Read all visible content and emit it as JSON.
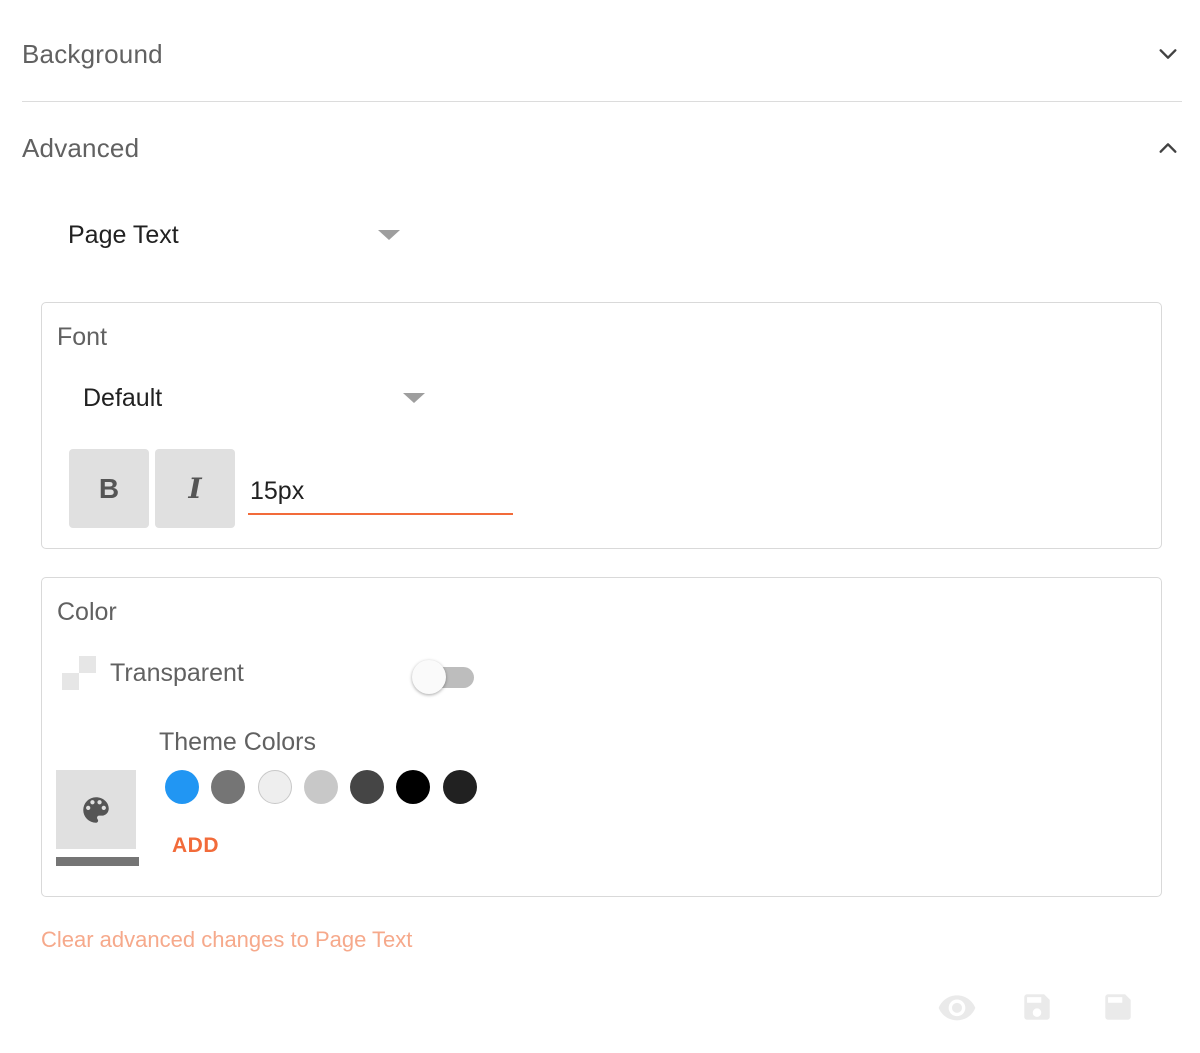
{
  "sections": {
    "background": {
      "title": "Background",
      "icon": "chevron-down-icon"
    },
    "advanced": {
      "title": "Advanced",
      "icon": "chevron-up-icon"
    }
  },
  "target_select": {
    "value": "Page Text"
  },
  "font_panel": {
    "title": "Font",
    "font_select": {
      "value": "Default"
    },
    "bold_label": "B",
    "italic_label": "I",
    "size": "15px"
  },
  "color_panel": {
    "title": "Color",
    "transparent_label": "Transparent",
    "transparent_on": false,
    "theme_colors_label": "Theme Colors",
    "swatches": [
      "#2196f3",
      "#757575",
      "#eeeeee",
      "#c8c8c8",
      "#454545",
      "#000000",
      "#212121"
    ],
    "add_label": "ADD"
  },
  "clear_label": "Clear advanced changes to Page Text",
  "footer_icons": [
    "eye-icon",
    "save-as-icon",
    "save-icon"
  ],
  "colors": {
    "accent": "#f26b3a",
    "accent_light": "#f6a98b"
  }
}
